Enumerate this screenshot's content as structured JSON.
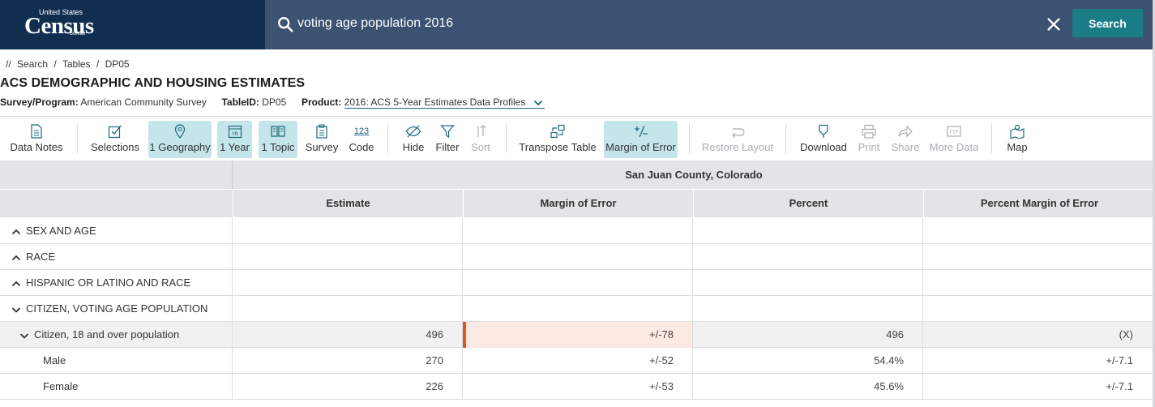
{
  "logo": {
    "line1": "United States",
    "line2": "Census",
    "line3": "Bureau"
  },
  "search": {
    "value": "voting age population 2016",
    "button_label": "Search"
  },
  "breadcrumb": {
    "prefix": "//",
    "items": [
      "Search",
      "Tables",
      "DP05"
    ],
    "separator": "/"
  },
  "page_title": "ACS DEMOGRAPHIC AND HOUSING ESTIMATES",
  "meta": {
    "survey_label": "Survey/Program:",
    "survey_value": "American Community Survey",
    "table_label": "TableID:",
    "table_value": "DP05",
    "product_label": "Product:",
    "product_value": "2016: ACS 5-Year Estimates Data Profiles"
  },
  "toolbar": {
    "data_notes": "Data Notes",
    "selections": "Selections",
    "geography": "1 Geography",
    "year": "1 Year",
    "topic": "1 Topic",
    "survey": "Survey",
    "code": "Code",
    "code_icon_text": "123",
    "hide": "Hide",
    "filter": "Filter",
    "sort": "Sort",
    "transpose": "Transpose Table",
    "moe": "Margin of Error",
    "restore": "Restore Layout",
    "download": "Download",
    "print": "Print",
    "share": "Share",
    "more_data": "More Data",
    "map": "Map"
  },
  "table": {
    "geography": "San Juan County, Colorado",
    "columns": [
      "Estimate",
      "Margin of Error",
      "Percent",
      "Percent Margin of Error"
    ],
    "rows": [
      {
        "label": "SEX AND AGE",
        "caret": "up",
        "values": [
          "",
          "",
          "",
          ""
        ]
      },
      {
        "label": "RACE",
        "caret": "up",
        "values": [
          "",
          "",
          "",
          ""
        ]
      },
      {
        "label": "HISPANIC OR LATINO AND RACE",
        "caret": "up",
        "values": [
          "",
          "",
          "",
          ""
        ]
      },
      {
        "label": "CITIZEN, VOTING AGE POPULATION",
        "caret": "down",
        "values": [
          "",
          "",
          "",
          ""
        ]
      },
      {
        "label": "Citizen, 18 and over population",
        "caret": "down",
        "values": [
          "496",
          "+/-78",
          "496",
          "(X)"
        ]
      },
      {
        "label": "Male",
        "caret": "",
        "values": [
          "270",
          "+/-52",
          "54.4%",
          "+/-7.1"
        ]
      },
      {
        "label": "Female",
        "caret": "",
        "values": [
          "226",
          "+/-53",
          "45.6%",
          "+/-7.1"
        ]
      }
    ]
  },
  "colors": {
    "header_bg": "#112e51",
    "search_bg": "#3b5273",
    "button_bg": "#1a7d88",
    "active_tool_bg": "#c4e5ea",
    "moe_highlight": "#e9541a"
  }
}
